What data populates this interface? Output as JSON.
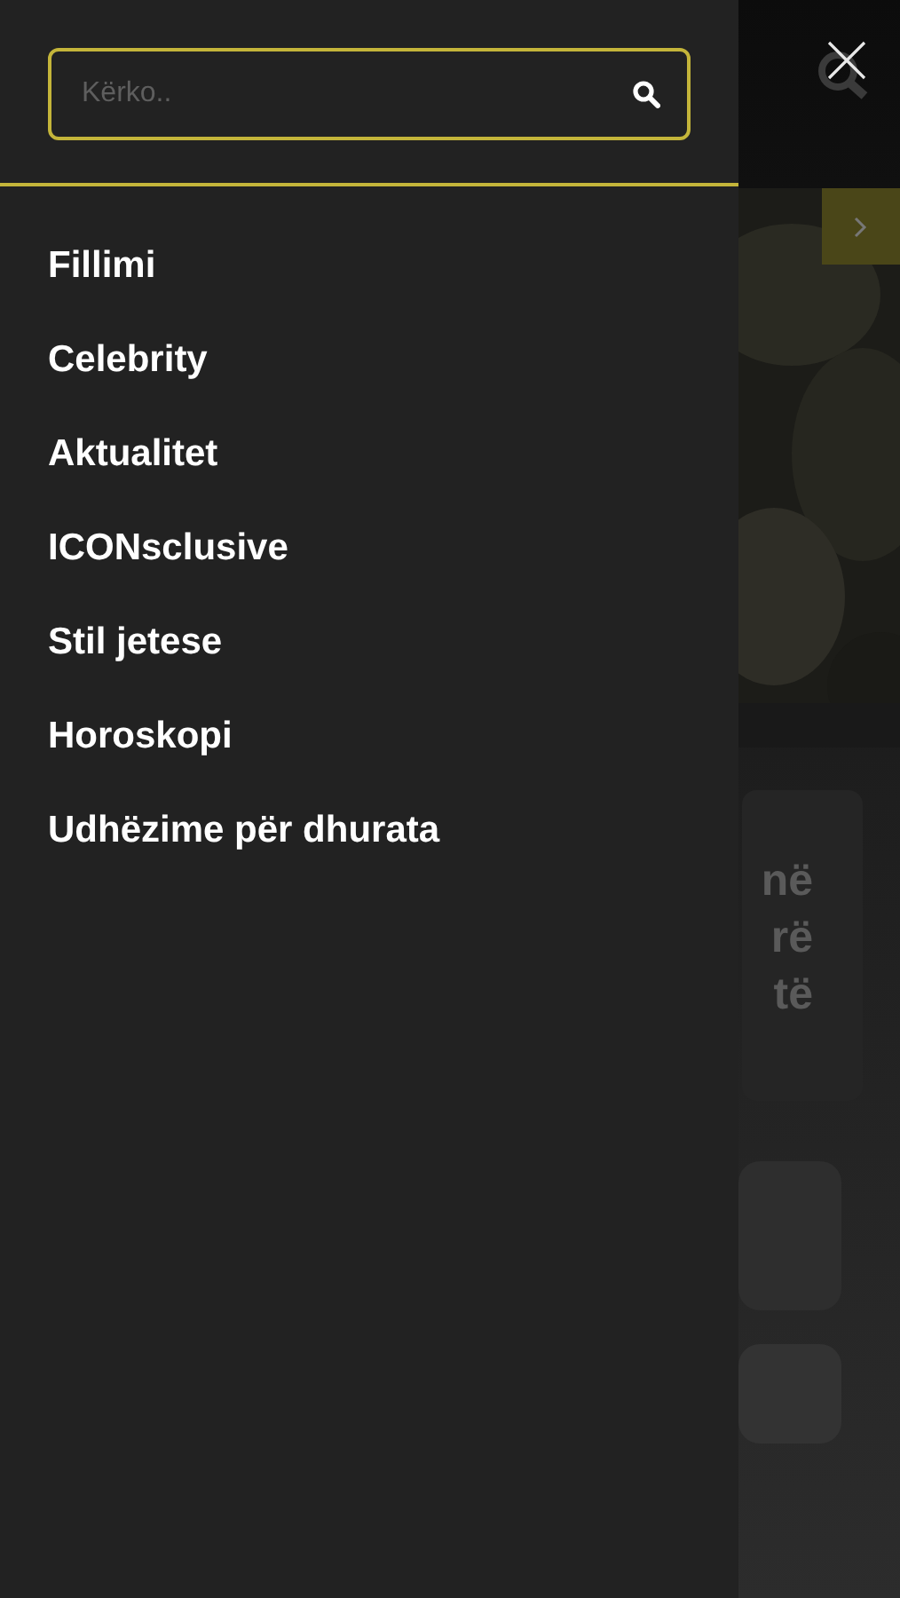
{
  "search": {
    "placeholder": "Kërko.."
  },
  "menu": {
    "items": [
      {
        "label": "Fillimi"
      },
      {
        "label": "Celebrity"
      },
      {
        "label": "Aktualitet"
      },
      {
        "label": "ICONsclusive"
      },
      {
        "label": "Stil jetese"
      },
      {
        "label": "Horoskopi"
      },
      {
        "label": "Udhëzime për dhurata"
      }
    ]
  },
  "background_page": {
    "headline_fragments": [
      "në",
      "rë",
      "të"
    ]
  }
}
